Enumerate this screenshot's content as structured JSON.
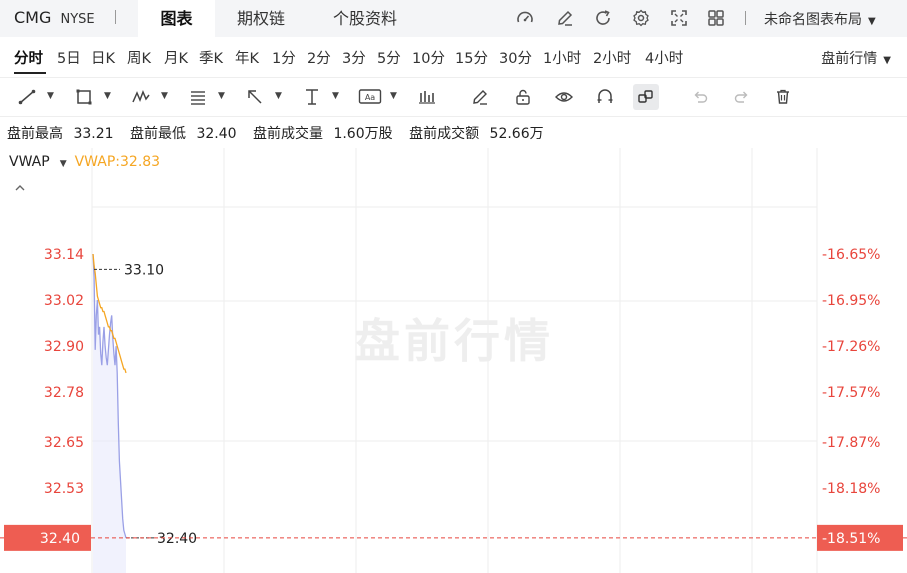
{
  "header": {
    "symbol": "CMG",
    "exchange": "NYSE",
    "tabs": [
      {
        "label": "图表",
        "active": true
      },
      {
        "label": "期权链",
        "active": false
      },
      {
        "label": "个股资料",
        "active": false
      }
    ],
    "layout_name": "未命名图表布局",
    "icons": [
      "speedometer-icon",
      "pen-edit-icon",
      "refresh-icon",
      "gear-icon",
      "fullscreen-icon",
      "grid-layout-icon"
    ]
  },
  "periods": {
    "items": [
      "分时",
      "5日",
      "日K",
      "周K",
      "月K",
      "季K",
      "年K",
      "1分",
      "2分",
      "3分",
      "5分",
      "10分",
      "15分",
      "30分",
      "1小时",
      "2小时",
      "4小时"
    ],
    "active": "分时",
    "session": "盘前行情"
  },
  "toolbar": {
    "icons": [
      "trend-line-icon",
      "rectangle-icon",
      "pattern-icon",
      "fib-icon",
      "arrow-icon",
      "measure-icon",
      "text-annotation-icon",
      "candle-type-icon",
      "pencil-icon",
      "lock-icon",
      "eye-icon",
      "magnet-icon",
      "link-icon",
      "undo-icon",
      "redo-icon",
      "trash-icon"
    ]
  },
  "stats": {
    "high_label": "盘前最高",
    "high": "33.21",
    "low_label": "盘前最低",
    "low": "32.40",
    "volume_label": "盘前成交量",
    "volume": "1.60万股",
    "turnover_label": "盘前成交额",
    "turnover": "52.66万"
  },
  "indicator": {
    "name": "VWAP",
    "value_text": "VWAP:32.83"
  },
  "chart_data": {
    "type": "line",
    "watermark": "盘前行情",
    "y_ticks": [
      "33.14",
      "33.02",
      "32.90",
      "32.78",
      "32.65",
      "32.53"
    ],
    "y_pct_ticks": [
      "-16.65%",
      "-16.95%",
      "-17.26%",
      "-17.57%",
      "-17.87%",
      "-18.18%"
    ],
    "ylim": [
      32.36,
      33.2
    ],
    "current_price": "32.40",
    "current_pct": "-18.51%",
    "current_value": 32.4,
    "markers": [
      {
        "label": "33.10",
        "value": 33.1
      },
      {
        "label": "32.40",
        "value": 32.4
      }
    ],
    "grid": true,
    "series": [
      {
        "name": "price",
        "color": "#9aa0e6",
        "x": [
          0,
          1,
          2,
          3,
          4,
          5,
          6,
          7,
          8,
          9,
          10,
          11,
          12,
          13,
          14,
          15,
          16,
          17,
          18,
          19,
          20,
          21,
          22,
          23,
          24,
          25,
          26,
          27,
          28,
          29,
          30
        ],
        "values": [
          33.14,
          33.08,
          32.89,
          32.98,
          33.02,
          32.93,
          32.95,
          32.88,
          32.85,
          32.91,
          32.95,
          32.9,
          32.87,
          32.85,
          32.89,
          32.93,
          32.96,
          32.98,
          32.92,
          32.88,
          32.85,
          32.9,
          32.83,
          32.7,
          32.6,
          32.55,
          32.5,
          32.45,
          32.42,
          32.41,
          32.4
        ]
      },
      {
        "name": "VWAP",
        "color": "#f5a623",
        "x": [
          0,
          1,
          2,
          3,
          4,
          5,
          6,
          7,
          8,
          9,
          10,
          11,
          12,
          13,
          14,
          15,
          16,
          17,
          18,
          19,
          20,
          21,
          22,
          23,
          24,
          25,
          26,
          27,
          28,
          29,
          30
        ],
        "values": [
          33.14,
          33.11,
          33.09,
          33.06,
          33.03,
          33.02,
          33.01,
          33.0,
          33.0,
          32.99,
          32.99,
          32.98,
          32.97,
          32.96,
          32.95,
          32.95,
          32.94,
          32.94,
          32.93,
          32.92,
          32.92,
          32.91,
          32.9,
          32.89,
          32.88,
          32.87,
          32.86,
          32.85,
          32.84,
          32.84,
          32.83
        ]
      }
    ]
  }
}
